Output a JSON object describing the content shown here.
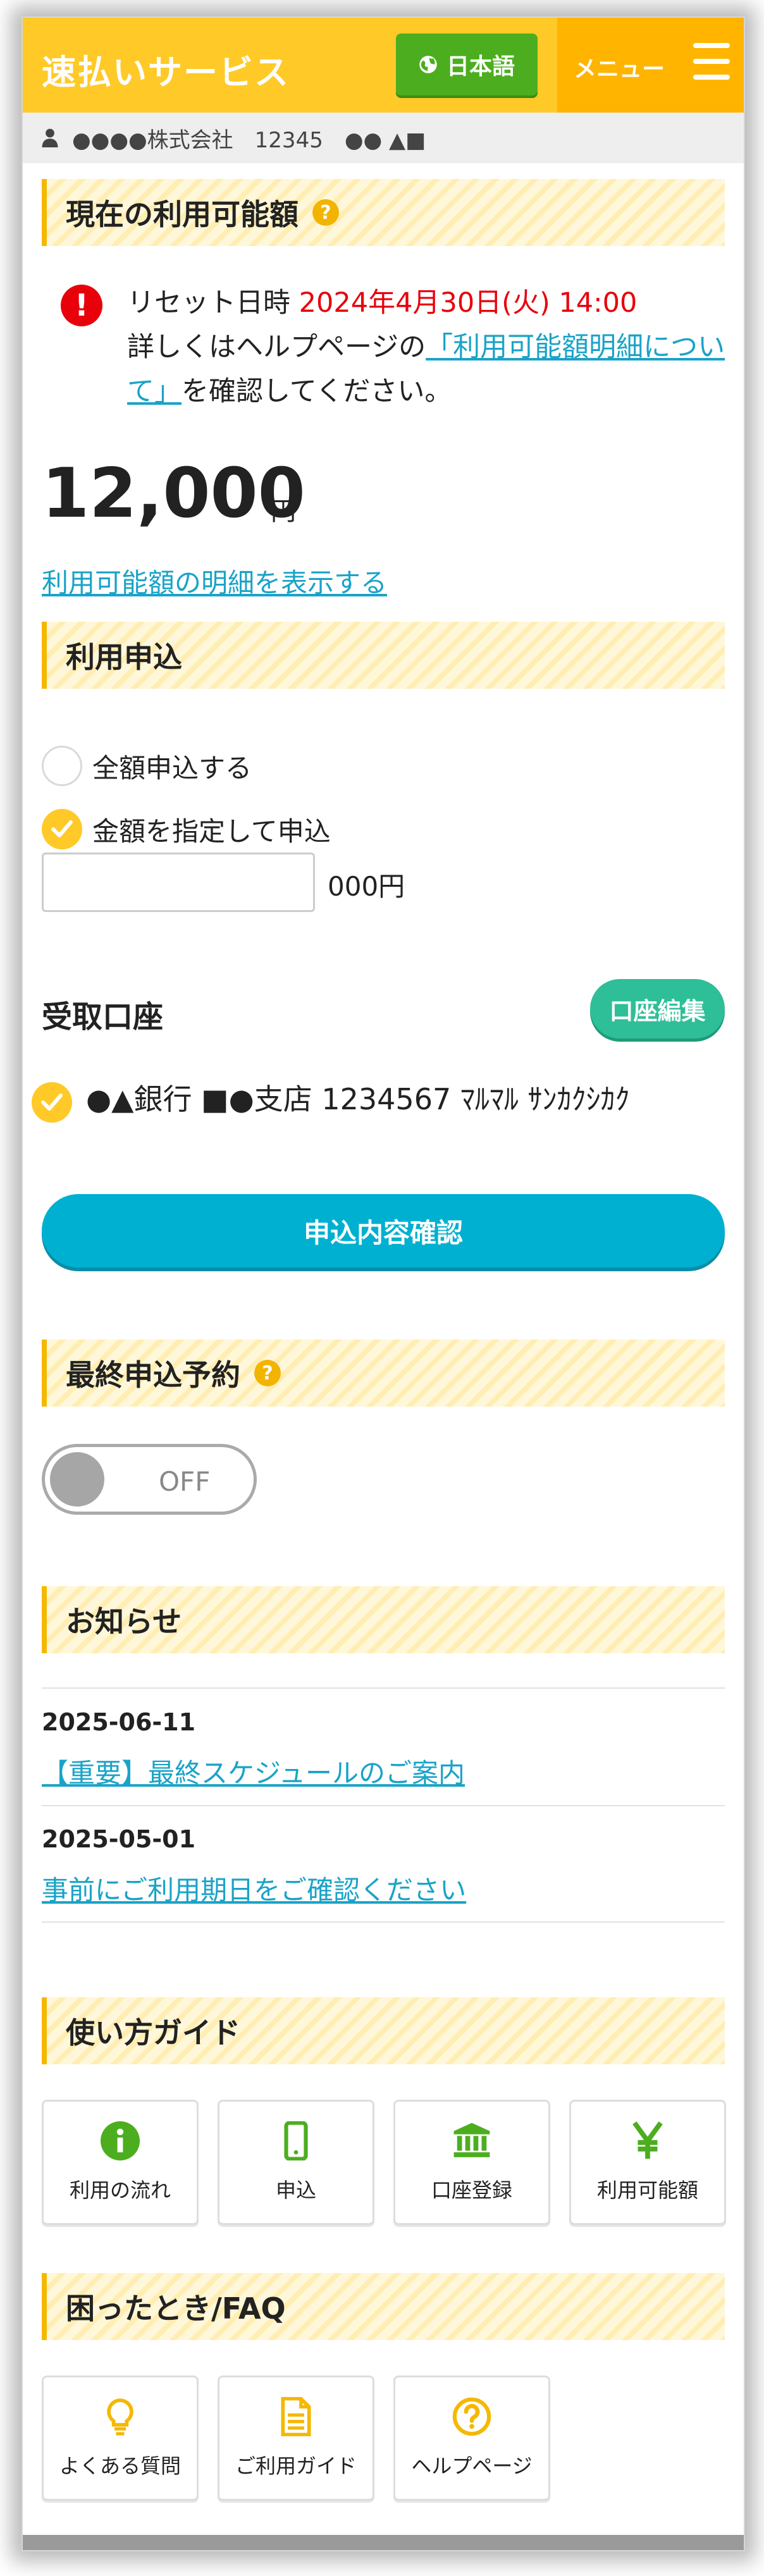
{
  "header": {
    "app_title": "速払いサービス",
    "lang_label": "日本語",
    "menu_label": "メニュー"
  },
  "user_bar": {
    "text": "●●●●株式会社　12345　●● ▲■"
  },
  "available": {
    "section_title": "現在の利用可能額",
    "reset_label": "リセット日時 ",
    "reset_datetime": "2024年4月30日(火) 14:00",
    "help_prefix": "詳しくはヘルプページの",
    "help_link": "「利用可能額明細について」",
    "help_suffix": "を確認してください。",
    "amount": "12,000",
    "unit": "円",
    "detail_link": "利用可能額の明細を表示する"
  },
  "application": {
    "section_title": "利用申込",
    "option_full": "全額申込する",
    "option_specify": "金額を指定して申込",
    "amount_input_value": "",
    "amount_suffix": "000円",
    "account_title": "受取口座",
    "edit_account_button": "口座編集",
    "account_text": "●▲銀行 ■●支店 1234567 ﾏﾙﾏﾙ ｻﾝｶｸｼｶｸ",
    "confirm_button": "申込内容確認"
  },
  "final_reservation": {
    "section_title": "最終申込予約",
    "toggle_label": "OFF",
    "toggle_on": false
  },
  "news": {
    "section_title": "お知らせ",
    "items": [
      {
        "date": "2025-06-11",
        "title": "【重要】最終スケジュールのご案内"
      },
      {
        "date": "2025-05-01",
        "title": "事前にご利用期日をご確認ください"
      }
    ]
  },
  "guide": {
    "section_title": "使い方ガイド",
    "tiles": [
      {
        "label": "利用の流れ",
        "icon": "info-icon",
        "color": "#4cae1f"
      },
      {
        "label": "申込",
        "icon": "smartphone-icon",
        "color": "#4cae1f"
      },
      {
        "label": "口座登録",
        "icon": "bank-icon",
        "color": "#4cae1f"
      },
      {
        "label": "利用可能額",
        "icon": "yen-icon",
        "color": "#4cae1f"
      }
    ]
  },
  "faq": {
    "section_title": "困ったとき/FAQ",
    "tiles": [
      {
        "label": "よくある質問",
        "icon": "lightbulb-icon",
        "color": "#f5b800"
      },
      {
        "label": "ご利用ガイド",
        "icon": "document-icon",
        "color": "#f5b800"
      },
      {
        "label": "ヘルプページ",
        "icon": "question-icon",
        "color": "#f5b800"
      }
    ]
  },
  "colors": {
    "header_bg": "#ffc928",
    "menu_bg": "#ffb400",
    "lang_button": "#4cae1f",
    "edit_button": "#2fbf98",
    "confirm_button": "#00b0d0",
    "link": "#1aa3c8",
    "alert_red": "#e8000b"
  }
}
